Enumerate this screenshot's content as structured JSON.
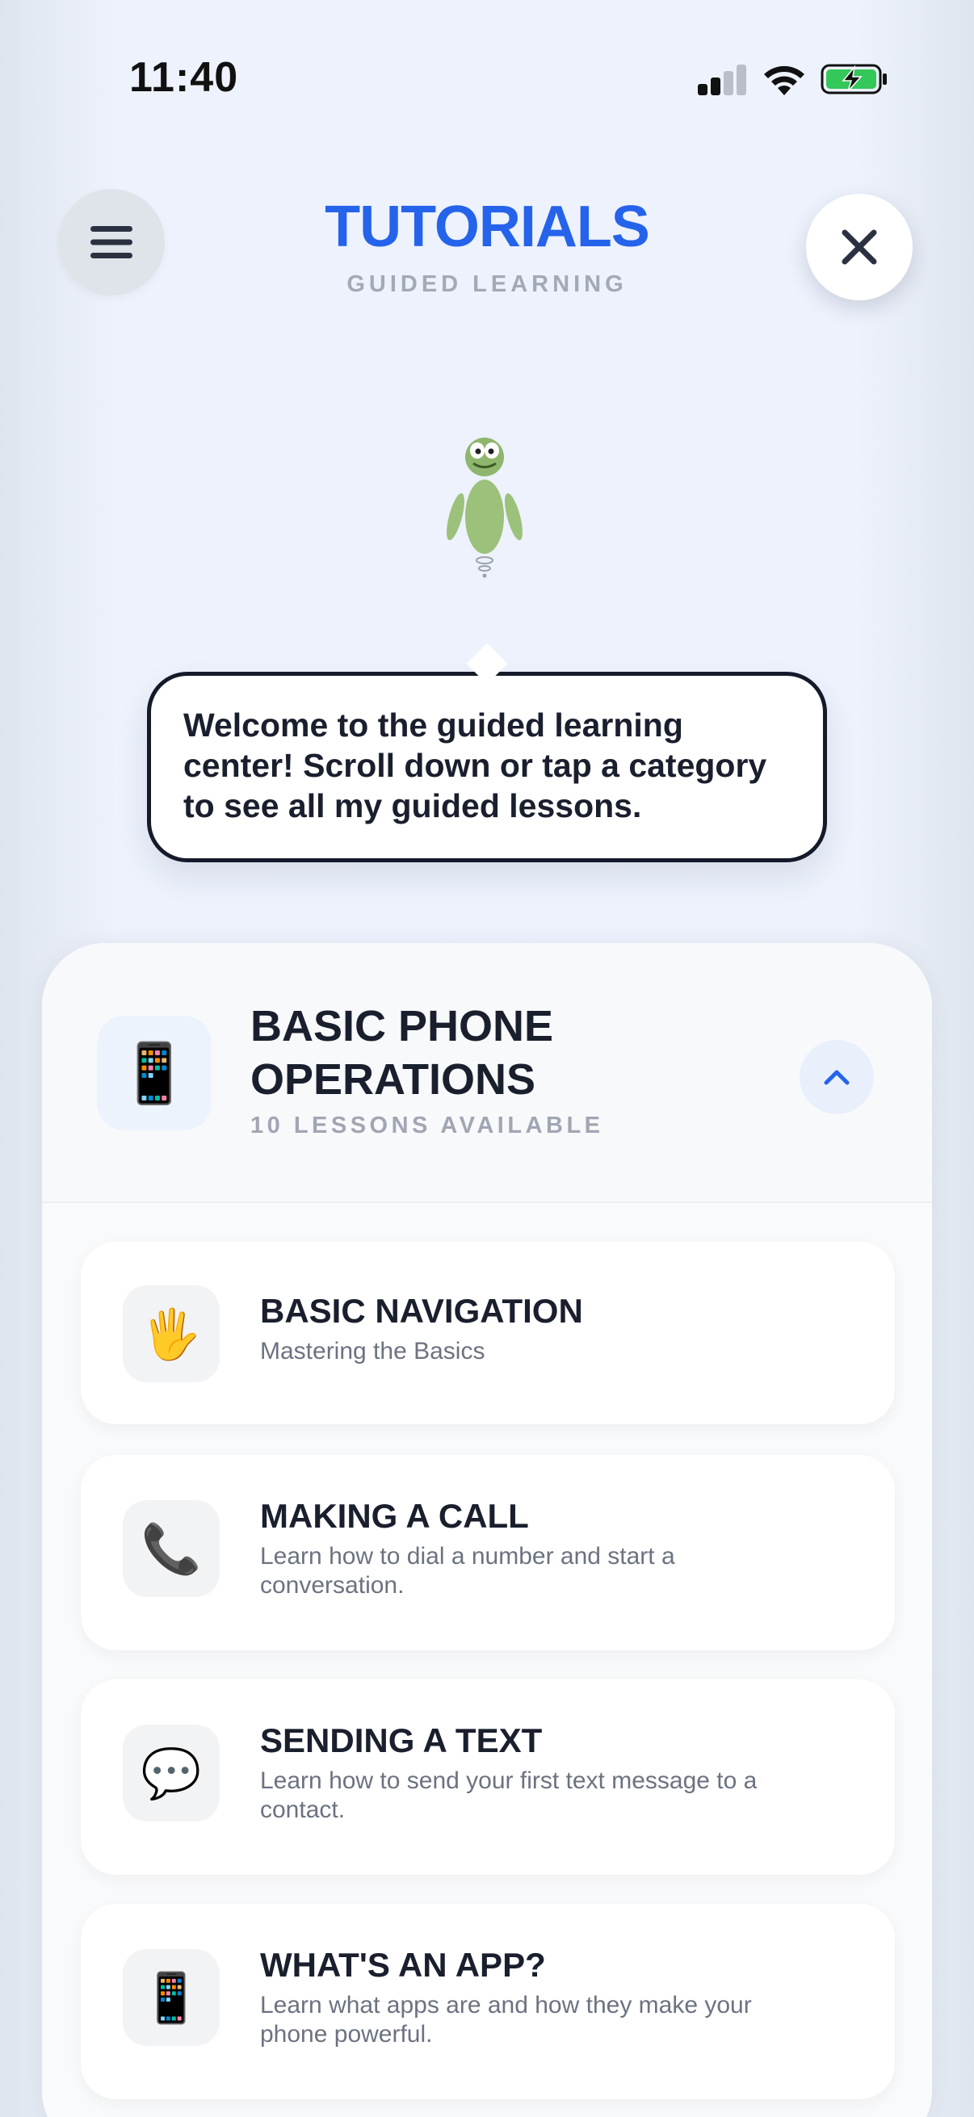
{
  "status_bar": {
    "time": "11:40",
    "icons": [
      "cellular-signal-icon",
      "wifi-icon",
      "battery-charging-icon"
    ],
    "battery_color": "#34c759"
  },
  "header": {
    "title": "TUTORIALS",
    "subtitle": "GUIDED LEARNING",
    "menu_icon": "hamburger-icon",
    "close_icon": "close-icon",
    "title_color": "#2563eb"
  },
  "mascot": {
    "icon": "alien-mascot-icon",
    "speech": "Welcome to the guided learning center! Scroll down or tap a category to see all my guided lessons."
  },
  "category": {
    "icon": "📱",
    "title": "BASIC PHONE OPERATIONS",
    "subtitle": "10 LESSONS AVAILABLE",
    "toggle_icon": "chevron-up-icon",
    "accent_color": "#2563eb",
    "lessons": [
      {
        "icon": "🖐",
        "title": "BASIC NAVIGATION",
        "description": "Mastering the Basics"
      },
      {
        "icon": "📞",
        "title": "MAKING A CALL",
        "description": "Learn how to dial a number and start a conversation."
      },
      {
        "icon": "💬",
        "title": "SENDING A TEXT",
        "description": "Learn how to send your first text message to a contact."
      },
      {
        "icon": "📱",
        "title": "WHAT'S AN APP?",
        "description": "Learn what apps are and how they make your phone powerful."
      }
    ]
  }
}
